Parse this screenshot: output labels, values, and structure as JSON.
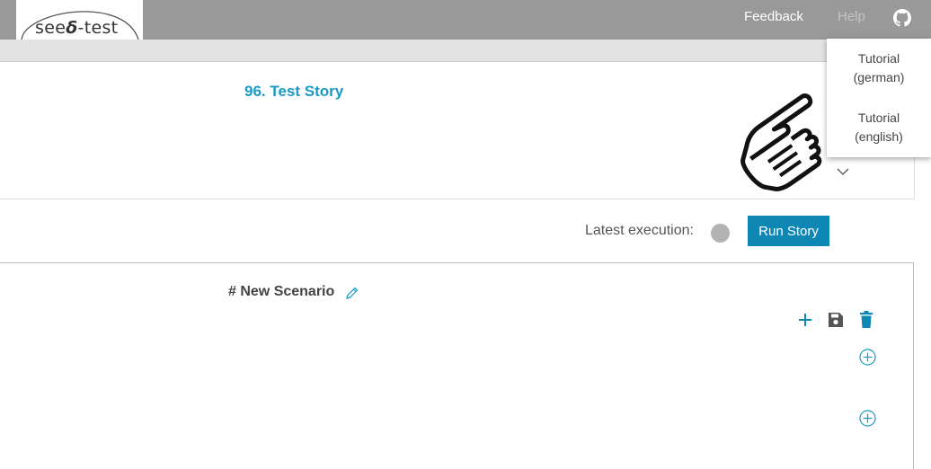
{
  "header": {
    "logo_text": "seeẟ-test",
    "logo_left": "see",
    "logo_right": "-test",
    "nav": {
      "feedback": "Feedback",
      "help": "Help"
    },
    "github_icon": "github-icon"
  },
  "story": {
    "title": "96. Test Story",
    "expand_icon": "chevron-down-icon"
  },
  "execution": {
    "label": "Latest execution:",
    "status_color": "#b3b3b3",
    "run_button": "Run Story"
  },
  "scenario": {
    "title": "# New Scenario",
    "edit_icon": "pencil-icon",
    "actions": [
      "plus-icon",
      "save-icon",
      "trash-icon"
    ],
    "add_step_icon": "plus-circle-icon"
  },
  "help_menu": {
    "items": [
      {
        "line1": "Tutorial",
        "line2": "(german)"
      },
      {
        "line1": "Tutorial",
        "line2": "(english)"
      }
    ]
  },
  "colors": {
    "accent": "#0e87b4",
    "title_link": "#1a9ac4",
    "topbar": "#999999"
  }
}
